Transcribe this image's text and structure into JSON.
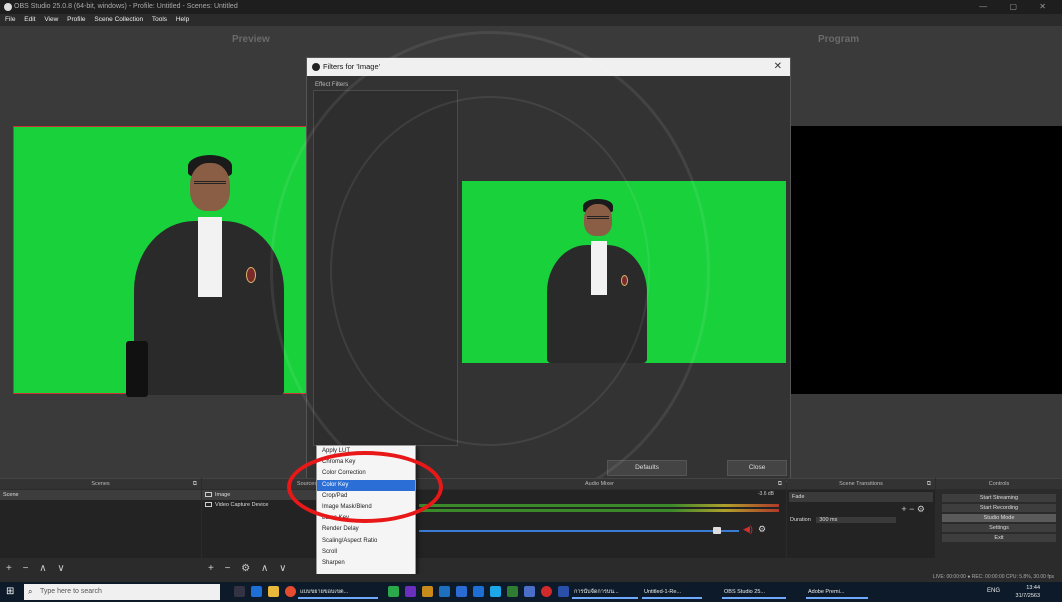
{
  "window": {
    "title": "OBS Studio 25.0.8 (64-bit, windows) - Profile: Untitled - Scenes: Untitled",
    "controls": "— ▢ ✕"
  },
  "menu": [
    "File",
    "Edit",
    "View",
    "Profile",
    "Scene Collection",
    "Tools",
    "Help"
  ],
  "headers": {
    "preview": "Preview",
    "program": "Program"
  },
  "filter_dialog": {
    "title": "Filters for 'Image'",
    "effect_filters_label": "Effect Filters",
    "footer_icons": "+ − ∧ ∨",
    "defaults_button": "Defaults",
    "close_button": "Close",
    "close_icon": "✕"
  },
  "context_menu": {
    "items": [
      "Apply LUT",
      "Chroma Key",
      "Color Correction",
      "Color Key",
      "Crop/Pad",
      "Image Mask/Blend",
      "Luma Key",
      "Render Delay",
      "Scaling/Aspect Ratio",
      "Scroll",
      "Sharpen"
    ],
    "highlighted_index": 3
  },
  "docks": {
    "scenes": {
      "title": "Scenes",
      "items": [
        "Scene"
      ],
      "footer": "+ − ∧ ∨"
    },
    "sources": {
      "title": "Sources",
      "items": [
        "Image",
        "Video Capture Device"
      ],
      "footer": "+ − ⚙ ∧ ∨"
    },
    "mixer": {
      "title": "Audio Mixer",
      "db": "-3.6 dB"
    },
    "transitions": {
      "title": "Scene Transitions",
      "transition": "Fade",
      "duration_label": "Duration",
      "duration_value": "300 ms",
      "buttons": "+ − ⚙"
    },
    "controls": {
      "title": "Controls",
      "buttons": [
        "Start Streaming",
        "Start Recording",
        "Studio Mode",
        "Settings",
        "Exit"
      ],
      "active_index": 2
    }
  },
  "status_bar": "LIVE: 00:00:00   ●  REC: 00:00:00     CPU: 5.8%, 30.00 fps",
  "taskbar": {
    "search_placeholder": "Type here to search",
    "apps": [
      "แบบขยายขอบเขต...",
      "การนับจัดการบน...",
      "Untitled-1-Re...",
      "OBS Studio 25...",
      "Adobe Premi..."
    ],
    "tray_lang": "ENG",
    "time": "13:44",
    "date": "31/7/2563"
  },
  "colors": {
    "green_screen": "#19d13b",
    "accent": "#2b6fd6",
    "annotation": "#e81818"
  }
}
